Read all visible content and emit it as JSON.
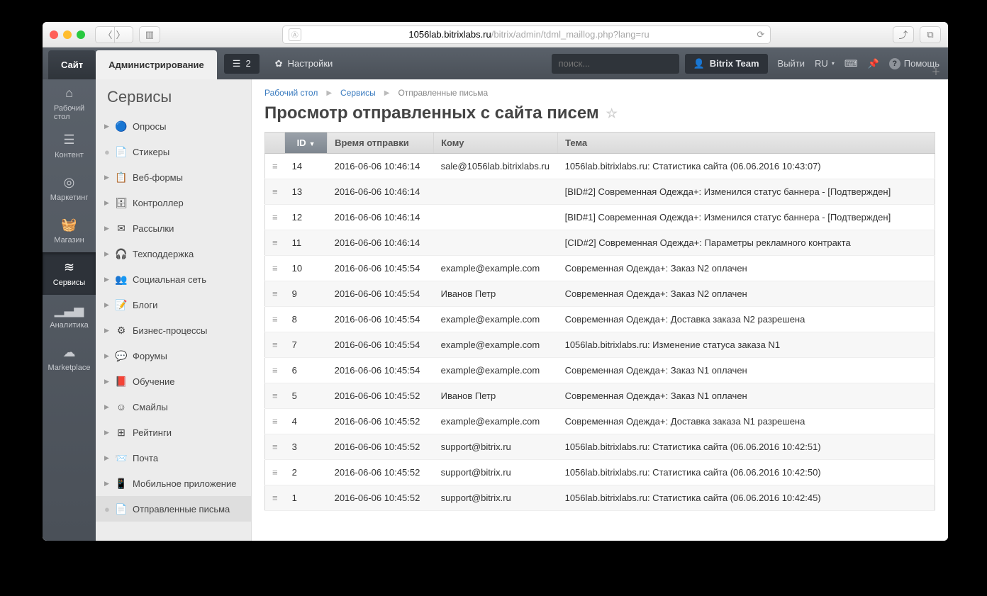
{
  "browser": {
    "url_prefix": "1056lab.bitrixlabs.ru",
    "url_suffix": "/bitrix/admin/tdml_maillog.php?lang=ru"
  },
  "topbar": {
    "tab_site": "Сайт",
    "tab_admin": "Администрирование",
    "notif_count": "2",
    "settings": "Настройки",
    "search_placeholder": "поиск...",
    "user": "Bitrix Team",
    "logout": "Выйти",
    "lang": "RU",
    "help": "Помощь"
  },
  "leftnav": [
    {
      "label": "Рабочий стол",
      "icon": "⌂"
    },
    {
      "label": "Контент",
      "icon": "☰"
    },
    {
      "label": "Маркетинг",
      "icon": "◎"
    },
    {
      "label": "Магазин",
      "icon": "🧺"
    },
    {
      "label": "Сервисы",
      "icon": "≋",
      "active": true
    },
    {
      "label": "Аналитика",
      "icon": "▁▃▅"
    },
    {
      "label": "Marketplace",
      "icon": "☁"
    }
  ],
  "subnav": {
    "title": "Сервисы",
    "items": [
      {
        "label": "Опросы",
        "icon": "🔵",
        "expandable": true
      },
      {
        "label": "Стикеры",
        "icon": "📄",
        "expandable": false
      },
      {
        "label": "Веб-формы",
        "icon": "📋",
        "expandable": true
      },
      {
        "label": "Контроллер",
        "icon": "🗄",
        "expandable": true
      },
      {
        "label": "Рассылки",
        "icon": "✉",
        "expandable": true
      },
      {
        "label": "Техподдержка",
        "icon": "🎧",
        "expandable": true
      },
      {
        "label": "Социальная сеть",
        "icon": "👥",
        "expandable": true
      },
      {
        "label": "Блоги",
        "icon": "📝",
        "expandable": true
      },
      {
        "label": "Бизнес-процессы",
        "icon": "⚙",
        "expandable": true
      },
      {
        "label": "Форумы",
        "icon": "💬",
        "expandable": true
      },
      {
        "label": "Обучение",
        "icon": "📕",
        "expandable": true
      },
      {
        "label": "Смайлы",
        "icon": "☺",
        "expandable": true
      },
      {
        "label": "Рейтинги",
        "icon": "⊞",
        "expandable": true
      },
      {
        "label": "Почта",
        "icon": "📨",
        "expandable": true
      },
      {
        "label": "Мобильное приложение",
        "icon": "📱",
        "expandable": true
      },
      {
        "label": "Отправленные письма",
        "icon": "📄",
        "expandable": false,
        "active": true
      }
    ]
  },
  "breadcrumb": [
    "Рабочий стол",
    "Сервисы",
    "Отправленные письма"
  ],
  "page_title": "Просмотр отправленных с сайта писем",
  "columns": {
    "id": "ID",
    "sent": "Время отправки",
    "to": "Кому",
    "subject": "Тема"
  },
  "rows": [
    {
      "id": "14",
      "sent": "2016-06-06 10:46:14",
      "to": "sale@1056lab.bitrixlabs.ru",
      "subject": "1056lab.bitrixlabs.ru: Статистика сайта (06.06.2016 10:43:07)"
    },
    {
      "id": "13",
      "sent": "2016-06-06 10:46:14",
      "to": "",
      "subject": "[BID#2] Современная Одежда+: Изменился статус баннера - [Подтвержден]"
    },
    {
      "id": "12",
      "sent": "2016-06-06 10:46:14",
      "to": "",
      "subject": "[BID#1] Современная Одежда+: Изменился статус баннера - [Подтвержден]"
    },
    {
      "id": "11",
      "sent": "2016-06-06 10:46:14",
      "to": "",
      "subject": "[CID#2] Современная Одежда+: Параметры рекламного контракта"
    },
    {
      "id": "10",
      "sent": "2016-06-06 10:45:54",
      "to": "example@example.com",
      "subject": "Современная Одежда+: Заказ N2 оплачен"
    },
    {
      "id": "9",
      "sent": "2016-06-06 10:45:54",
      "to": "Иванов Петр",
      "subject": "Современная Одежда+: Заказ N2 оплачен"
    },
    {
      "id": "8",
      "sent": "2016-06-06 10:45:54",
      "to": "example@example.com",
      "subject": "Современная Одежда+: Доставка заказа N2 разрешена"
    },
    {
      "id": "7",
      "sent": "2016-06-06 10:45:54",
      "to": "example@example.com",
      "subject": "1056lab.bitrixlabs.ru: Изменение статуса заказа N1"
    },
    {
      "id": "6",
      "sent": "2016-06-06 10:45:54",
      "to": "example@example.com",
      "subject": "Современная Одежда+: Заказ N1 оплачен"
    },
    {
      "id": "5",
      "sent": "2016-06-06 10:45:52",
      "to": "Иванов Петр",
      "subject": "Современная Одежда+: Заказ N1 оплачен"
    },
    {
      "id": "4",
      "sent": "2016-06-06 10:45:52",
      "to": "example@example.com",
      "subject": "Современная Одежда+: Доставка заказа N1 разрешена"
    },
    {
      "id": "3",
      "sent": "2016-06-06 10:45:52",
      "to": "support@bitrix.ru",
      "subject": "1056lab.bitrixlabs.ru: Статистика сайта (06.06.2016 10:42:51)"
    },
    {
      "id": "2",
      "sent": "2016-06-06 10:45:52",
      "to": "support@bitrix.ru",
      "subject": "1056lab.bitrixlabs.ru: Статистика сайта (06.06.2016 10:42:50)"
    },
    {
      "id": "1",
      "sent": "2016-06-06 10:45:52",
      "to": "support@bitrix.ru",
      "subject": "1056lab.bitrixlabs.ru: Статистика сайта (06.06.2016 10:42:45)"
    }
  ]
}
